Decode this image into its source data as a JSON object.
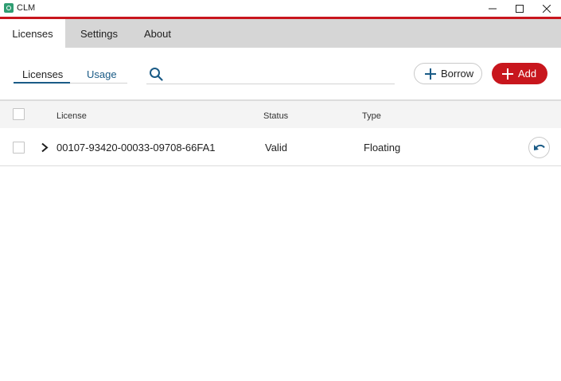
{
  "window": {
    "title": "CLM",
    "icons": {
      "app": "clm-logo-icon",
      "minimize": "minimize-icon",
      "maximize": "maximize-icon",
      "close": "close-icon"
    }
  },
  "main_tabs": [
    {
      "label": "Licenses",
      "active": true
    },
    {
      "label": "Settings",
      "active": false
    },
    {
      "label": "About",
      "active": false
    }
  ],
  "sub_tabs": [
    {
      "label": "Licenses",
      "active": true
    },
    {
      "label": "Usage",
      "active": false
    }
  ],
  "search": {
    "placeholder": "",
    "value": "",
    "icon": "search-icon"
  },
  "actions": {
    "borrow_label": "Borrow",
    "add_label": "Add"
  },
  "table": {
    "columns": [
      "License",
      "Status",
      "Type"
    ],
    "rows": [
      {
        "license": "00107-93420-00033-09708-66FA1",
        "status": "Valid",
        "type": "Floating",
        "checked": false
      }
    ]
  },
  "colors": {
    "accent_red": "#c8161d",
    "accent_blue": "#1a5b86",
    "tabbar_gray": "#d6d6d6"
  }
}
